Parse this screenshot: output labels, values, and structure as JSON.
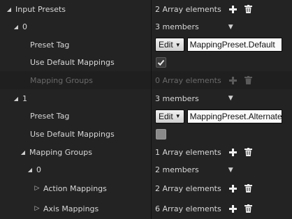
{
  "rows": {
    "input_presets": {
      "label": "Input Presets",
      "value": "2 Array elements"
    },
    "idx0": {
      "label": "0",
      "value": "3 members"
    },
    "preset_tag_0": {
      "label": "Preset Tag",
      "edit": "Edit",
      "tag": "MappingPreset.Default"
    },
    "use_default_0": {
      "label": "Use Default Mappings",
      "checked": true
    },
    "mapping_groups_0": {
      "label": "Mapping Groups",
      "value": "0 Array elements"
    },
    "idx1": {
      "label": "1",
      "value": "3 members"
    },
    "preset_tag_1": {
      "label": "Preset Tag",
      "edit": "Edit",
      "tag": "MappingPreset.Alternate"
    },
    "use_default_1": {
      "label": "Use Default Mappings",
      "checked": false
    },
    "mapping_groups_1": {
      "label": "Mapping Groups",
      "value": "1 Array elements"
    },
    "group_idx0": {
      "label": "0",
      "value": "2 members"
    },
    "action_mappings": {
      "label": "Action Mappings",
      "value": "2 Array elements"
    },
    "axis_mappings": {
      "label": "Axis Mappings",
      "value": "6 Array elements"
    }
  }
}
